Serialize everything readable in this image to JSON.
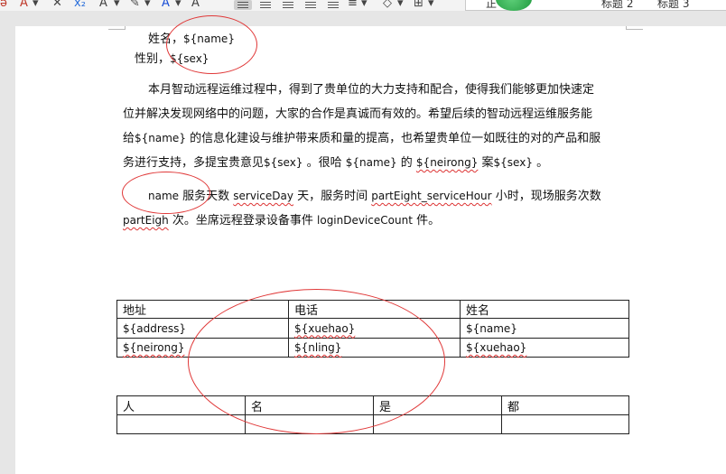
{
  "toolbar": {
    "icons": [
      "strikethrough-icon",
      "clear-format-icon",
      "subscript-icon",
      "text-effect-icon",
      "highlight-icon",
      "font-color-icon",
      "char-shading-icon"
    ],
    "style_normal": "正",
    "style_heading2": "标题 2",
    "style_heading3": "标题 3"
  },
  "doc": {
    "line1_label": "姓名，",
    "line1_value": "${name}",
    "line2_label": "性别，",
    "line2_value": "${sex}",
    "para1": {
      "l1": "本月智动远程运维过程中，得到了贵单位的大力支持和配合，使得我们能够更加快速定",
      "l2": "位并解决发现网络中的问题，大家的合作是真诚而有效的。希望后续的智动远程运维服务能",
      "l3_a": "给",
      "l3_b": "${name}",
      "l3_c": " 的信息化建设与维护带来质和量的提高，也希望贵单位一如既往的对的产品和服",
      "l4_a": "务进行支持，多提宝贵意见",
      "l4_b": "${sex}",
      "l4_c": " 。很哈 ",
      "l4_d": "${name}",
      "l4_e": " 的 ",
      "l4_f": "${neirong}",
      "l4_g": " 案",
      "l4_h": "${sex}",
      "l4_i": " 。"
    },
    "para2": {
      "a": "name",
      "b": " 服务天数 ",
      "c": "serviceDay",
      "d": " 天，服务时间 ",
      "e": "partEight_serviceHour",
      "f": " 小时，现场服务次数",
      "g": "partEigh",
      "h": " 次。坐席远程登录设备事件 ",
      "i": "loginDeviceCount",
      "j": " 件。"
    },
    "table1": {
      "headers": [
        "地址",
        "电话",
        "姓名"
      ],
      "rows": [
        [
          "${address}",
          "${xuehao}",
          "${name}"
        ],
        [
          "${neirong}",
          "${nling}",
          "${xuehao}"
        ]
      ]
    },
    "table2": {
      "headers": [
        "人",
        "名",
        "是",
        "都"
      ]
    }
  }
}
